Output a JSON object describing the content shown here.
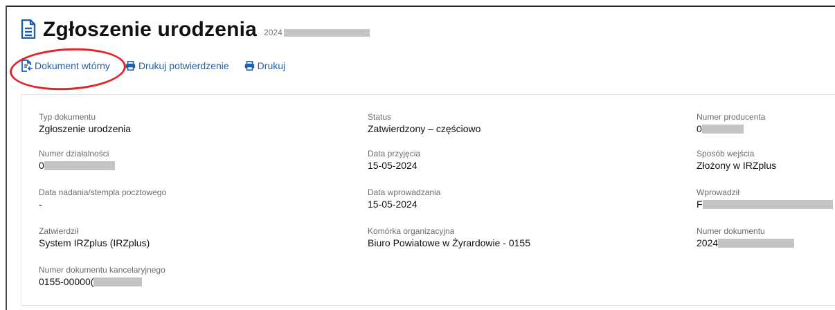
{
  "header": {
    "title": "Zgłoszenie urodzenia",
    "number_prefix": "2024"
  },
  "toolbar": {
    "secondary_doc_label": "Dokument wtórny",
    "print_confirmation_label": "Drukuj potwierdzenie",
    "print_label": "Drukuj"
  },
  "colors": {
    "link": "#1f5fae",
    "highlight": "#e0242a"
  },
  "icons": {
    "title": "document-icon",
    "secondary_doc": "document-copy-icon",
    "print": "printer-icon"
  },
  "details": {
    "doc_type": {
      "label": "Typ dokumentu",
      "value": "Zgłoszenie urodzenia"
    },
    "status": {
      "label": "Status",
      "value": "Zatwierdzony – częściowo"
    },
    "producer_number": {
      "label": "Numer producenta",
      "value": "0"
    },
    "activity_number": {
      "label": "Numer działalności",
      "value": "0"
    },
    "receipt_date": {
      "label": "Data przyjęcia",
      "value": "15-05-2024"
    },
    "entry_method": {
      "label": "Sposób wejścia",
      "value": "Złożony w IRZplus"
    },
    "postmark_date": {
      "label": "Data nadania/stempla pocztowego",
      "value": "-"
    },
    "entry_date": {
      "label": "Data wprowadzania",
      "value": "15-05-2024"
    },
    "entered_by": {
      "label": "Wprowadził",
      "value": "F"
    },
    "approved_by": {
      "label": "Zatwierdził",
      "value": "System IRZplus (IRZplus)"
    },
    "org_unit": {
      "label": "Komórka organizacyjna",
      "value": "Biuro Powiatowe w Żyrardowie - 0155"
    },
    "doc_number": {
      "label": "Numer dokumentu",
      "value": "2024"
    },
    "office_doc_number": {
      "label": "Numer dokumentu kancelaryjnego",
      "value": "0155-00000("
    }
  }
}
